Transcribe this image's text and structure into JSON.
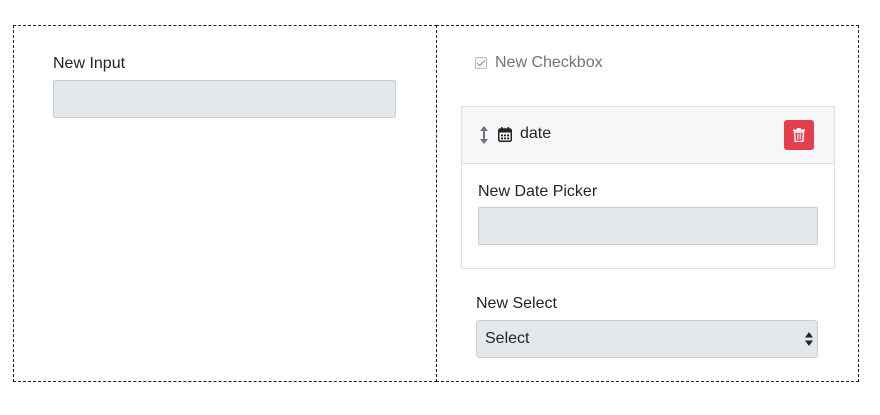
{
  "left_column": {
    "input_label": "New Input",
    "input_value": ""
  },
  "right_column": {
    "checkbox": {
      "label": "New Checkbox",
      "checked": true
    },
    "date_card": {
      "title": "date",
      "field_label": "New Date Picker",
      "field_value": "",
      "icons": [
        "move-vertical-icon",
        "calendar-icon",
        "trash-icon"
      ]
    },
    "select": {
      "label": "New Select",
      "selected": "Select"
    }
  },
  "colors": {
    "field_bg": "#e5e8eb",
    "delete_button": "#e53e4d",
    "card_header_bg": "#f7f7f7"
  }
}
